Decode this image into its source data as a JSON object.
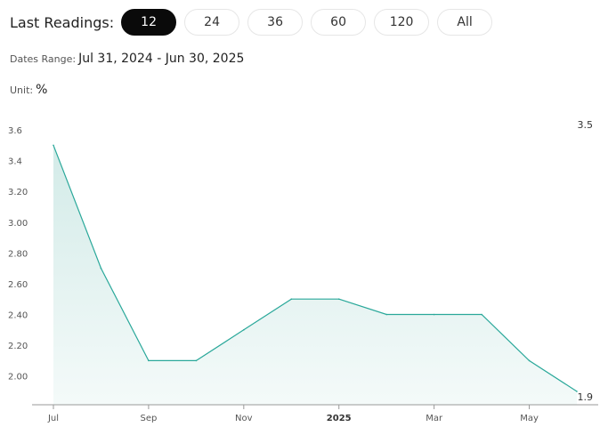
{
  "controls": {
    "label": "Last Readings:",
    "options": [
      "12",
      "24",
      "36",
      "60",
      "120",
      "All"
    ],
    "selected": "12"
  },
  "meta": {
    "dates_label": "Dates Range:",
    "dates_value": "Jul 31, 2024 - Jun 30, 2025",
    "unit_label": "Unit:",
    "unit_value": "%"
  },
  "colors": {
    "line": "#2aa89a",
    "fill": "#d3ebe8"
  },
  "chart_data": {
    "type": "area",
    "x": [
      "2024-07-31",
      "2024-08-31",
      "2024-09-30",
      "2024-10-31",
      "2024-11-30",
      "2024-12-31",
      "2025-01-31",
      "2025-02-28",
      "2025-03-31",
      "2025-04-30",
      "2025-05-31",
      "2025-06-30"
    ],
    "values": [
      3.5,
      2.7,
      2.1,
      2.1,
      2.3,
      2.5,
      2.5,
      2.4,
      2.4,
      2.4,
      2.1,
      1.9
    ],
    "ylim": [
      1.9,
      3.6
    ],
    "yticks": [
      "2.00",
      "2.20",
      "2.40",
      "2.60",
      "2.80",
      "3.00",
      "3.20",
      "3.4",
      "3.6"
    ],
    "xticks": [
      "Jul",
      "Sep",
      "Nov",
      "2025",
      "Mar",
      "May"
    ],
    "max_label": "3.5",
    "last_label": "1.9",
    "grid": false
  }
}
